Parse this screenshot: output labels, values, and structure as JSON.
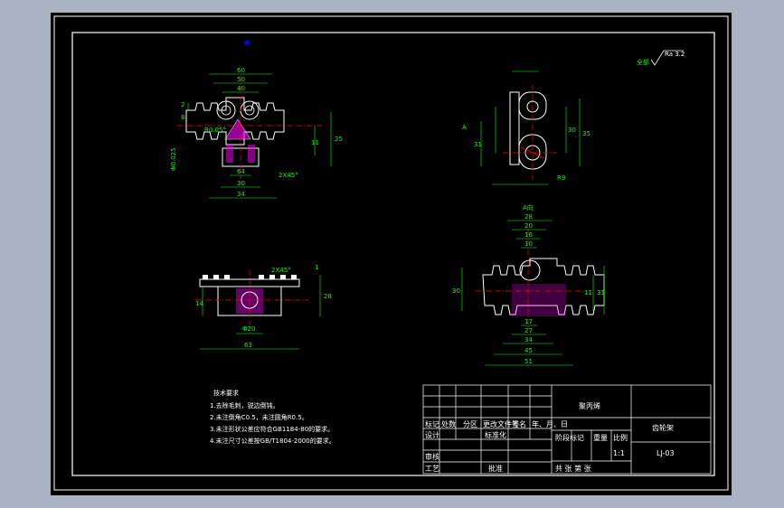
{
  "colors": {
    "background": "#000000",
    "outline": "#ffffff",
    "dimension": "#00ff00",
    "center_line": "#ff0000",
    "hatch": "#ff00ff",
    "ucs": "#0000ff",
    "frame": "#aab3c4"
  },
  "roughness": {
    "label": "全部",
    "value": "Ra 3.2"
  },
  "views": {
    "front": {
      "dims": [
        "60",
        "50",
        "40",
        "R0.05°",
        "2",
        "8",
        "11",
        "25",
        "20",
        "64",
        "2X45°",
        "30",
        "34",
        "Φ0.025"
      ]
    },
    "side": {
      "dims": [
        "A",
        "31",
        "30",
        "35",
        "R9",
        "A"
      ]
    },
    "section": {
      "title": "A向",
      "dims": [
        "28",
        "20",
        "16",
        "10",
        "9",
        "17",
        "27",
        "34",
        "45",
        "51",
        "30",
        "31",
        "11"
      ]
    },
    "bottom": {
      "dims": [
        "2X45°",
        "1",
        "28",
        "14",
        "Φ20",
        "63"
      ]
    }
  },
  "notes": {
    "title": "技术要求",
    "items": [
      "1.去除毛刺，锐边倒钝。",
      "2.未注倒角C0.5，未注圆角R0.5。",
      "3.未注形状公差应符合GB1184-80的要求。",
      "4.未注尺寸公差按GB/T1804-2000的要求。"
    ]
  },
  "title_block": {
    "material": "聚丙烯",
    "part_name": "齿轮架",
    "drawing_no": "LJ-03",
    "headers": [
      "标记",
      "处数",
      "分区",
      "更改文件号",
      "签名",
      "年、月、日"
    ],
    "design": "设计",
    "standard": "标准化",
    "review": "审核",
    "process": "工艺",
    "approve": "批准",
    "stage": "阶段标记",
    "weight": "重量",
    "scale": "比例",
    "scale_value": "1:1",
    "sheet": "共   张   第   张"
  }
}
